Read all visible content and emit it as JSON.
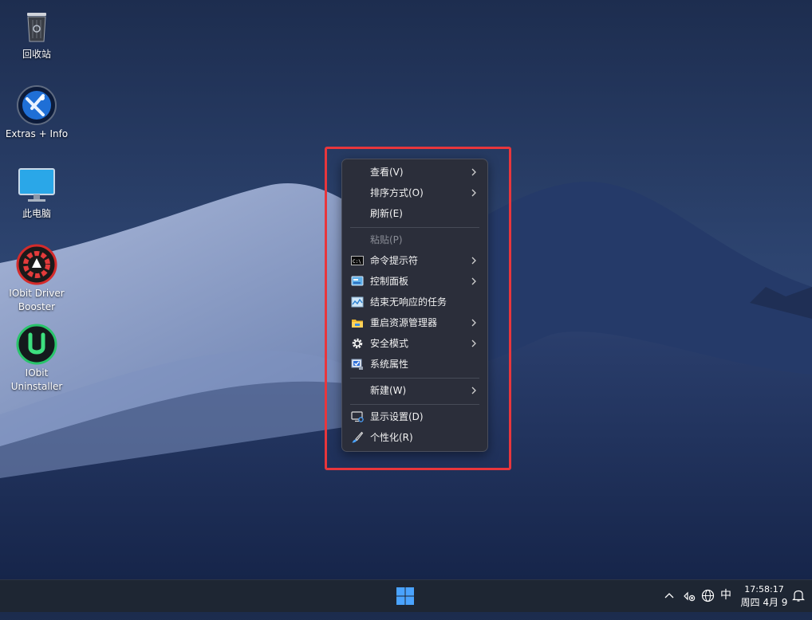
{
  "desktop": {
    "icons": [
      {
        "label": "回收站",
        "icon": "recycle-bin-icon"
      },
      {
        "label": "Extras + Info",
        "icon": "extras-info-icon"
      },
      {
        "label": "此电脑",
        "icon": "this-pc-icon"
      },
      {
        "label": "IObit Driver Booster",
        "icon": "driver-booster-icon"
      },
      {
        "label": "IObit Uninstaller",
        "icon": "uninstaller-icon"
      }
    ]
  },
  "context_menu": {
    "items": [
      {
        "label": "查看(V)",
        "has_submenu": true,
        "icon": null
      },
      {
        "label": "排序方式(O)",
        "has_submenu": true,
        "icon": null
      },
      {
        "label": "刷新(E)",
        "has_submenu": false,
        "icon": null
      },
      {
        "label": "粘贴(P)",
        "has_submenu": false,
        "icon": null,
        "disabled": true
      },
      {
        "label": "命令提示符",
        "has_submenu": true,
        "icon": "cmd-icon"
      },
      {
        "label": "控制面板",
        "has_submenu": true,
        "icon": "control-panel-icon"
      },
      {
        "label": "结束无响应的任务",
        "has_submenu": false,
        "icon": "task-monitor-icon"
      },
      {
        "label": "重启资源管理器",
        "has_submenu": true,
        "icon": "folder-icon"
      },
      {
        "label": "安全模式",
        "has_submenu": true,
        "icon": "gear-icon"
      },
      {
        "label": "系统属性",
        "has_submenu": false,
        "icon": "system-properties-icon"
      },
      {
        "label": "新建(W)",
        "has_submenu": true,
        "icon": null
      },
      {
        "label": "显示设置(D)",
        "has_submenu": false,
        "icon": "display-settings-icon"
      },
      {
        "label": "个性化(R)",
        "has_submenu": false,
        "icon": "personalize-brush-icon"
      }
    ],
    "highlight_color": "#e8363c"
  },
  "taskbar": {
    "start_icon": "windows-start-icon",
    "tray": {
      "chevron_icon": "chevron-up-icon",
      "network_icon": "network-disconnected-icon",
      "globe_icon": "globe-icon",
      "ime_label": "中",
      "notification_icon": "bell-icon"
    },
    "clock": {
      "time": "17:58:17",
      "date": "周四 4月 9"
    }
  },
  "colors": {
    "accent_blue": "#4aa3ff",
    "menu_bg": "#2b2e3a",
    "taskbar_bg": "#1e2633"
  }
}
